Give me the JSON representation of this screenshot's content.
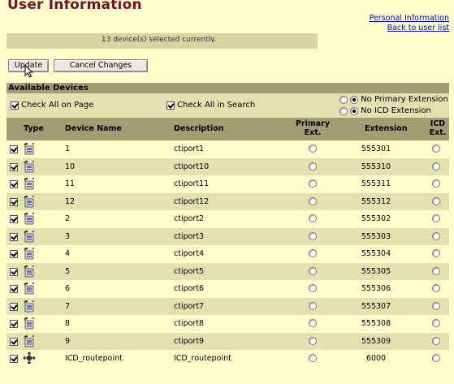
{
  "page": {
    "title": "User Information",
    "links": {
      "personal": "Personal Information",
      "back": "Back to user list"
    },
    "status": "13 device(s) selected currently."
  },
  "buttons": {
    "update": "Update",
    "cancel": "Cancel Changes"
  },
  "devices_section": {
    "heading": "Available Devices",
    "check_page_label": "Check All on Page",
    "check_search_label": "Check All in Search",
    "no_primary_label": "No Primary Extension",
    "no_icd_label": "No ICD Extension"
  },
  "columns": {
    "type": "Type",
    "device_name": "Device Name",
    "description": "Description",
    "primary_ext": [
      "Primary",
      "Ext."
    ],
    "extension": "Extension",
    "icd_ext": [
      "ICD",
      "Ext."
    ]
  },
  "rows": [
    {
      "device": "1",
      "description": "ctiport1",
      "extension": "555301",
      "type": "phone"
    },
    {
      "device": "10",
      "description": "ctiport10",
      "extension": "555310",
      "type": "phone"
    },
    {
      "device": "11",
      "description": "ctiport11",
      "extension": "555311",
      "type": "phone"
    },
    {
      "device": "12",
      "description": "ctiport12",
      "extension": "555312",
      "type": "phone"
    },
    {
      "device": "2",
      "description": "ctiport2",
      "extension": "555302",
      "type": "phone"
    },
    {
      "device": "3",
      "description": "ctiport3",
      "extension": "555303",
      "type": "phone"
    },
    {
      "device": "4",
      "description": "ctiport4",
      "extension": "555304",
      "type": "phone"
    },
    {
      "device": "5",
      "description": "ctiport5",
      "extension": "555305",
      "type": "phone"
    },
    {
      "device": "6",
      "description": "ctiport6",
      "extension": "555306",
      "type": "phone"
    },
    {
      "device": "7",
      "description": "ctiport7",
      "extension": "555307",
      "type": "phone"
    },
    {
      "device": "8",
      "description": "ctiport8",
      "extension": "555308",
      "type": "phone"
    },
    {
      "device": "9",
      "description": "ctiport9",
      "extension": "555309",
      "type": "phone"
    },
    {
      "device": "ICD_routepoint",
      "description": "ICD_routepoint",
      "extension": "6000",
      "type": "routepoint"
    }
  ]
}
